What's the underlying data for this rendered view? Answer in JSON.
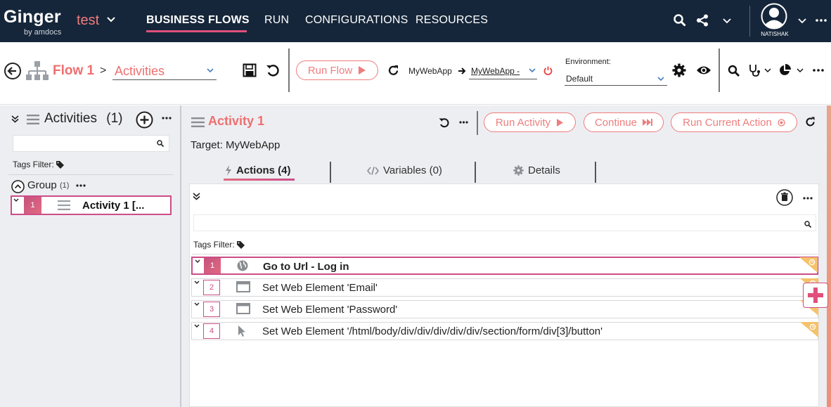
{
  "topbar": {
    "logo": "Ginger",
    "logo_sub": "by amdocs",
    "solution": "test",
    "nav": [
      "BUSINESS FLOWS",
      "RUN",
      "CONFIGURATIONS",
      "RESOURCES"
    ],
    "active_nav": "BUSINESS FLOWS",
    "user": "NATISHAK",
    "icons": [
      "search-icon",
      "share-icon",
      "chevron-down-icon",
      "avatar",
      "more-icon"
    ]
  },
  "toolbar": {
    "flow_name": "Flow 1",
    "separator": ">",
    "view_value": "Activities",
    "run_flow_label": "Run Flow",
    "app_name": "MyWebApp",
    "agent_value": "MyWebApp -",
    "environment_label": "Environment:",
    "environment_value": "Default"
  },
  "left_panel": {
    "title": "Activities",
    "count": "(1)",
    "tags_filter_label": "Tags Filter:",
    "group": {
      "label": "Group",
      "count": "(1)"
    },
    "activities": [
      {
        "number": "1",
        "name": "Activity 1 [..."
      }
    ]
  },
  "activity": {
    "title": "Activity 1",
    "run_activity_label": "Run Activity",
    "continue_label": "Continue",
    "run_current_action_label": "Run Current Action",
    "target": "Target: MyWebApp",
    "tabs": [
      {
        "label": "Actions (4)",
        "icon": "lightning-icon"
      },
      {
        "label": "Variables (0)",
        "icon": "code-icon"
      },
      {
        "label": "Details",
        "icon": "gear-icon"
      }
    ],
    "tags_filter_label": "Tags Filter:",
    "actions": [
      {
        "number": "1",
        "icon": "globe-icon",
        "text": "Go to Url - Log in"
      },
      {
        "number": "2",
        "icon": "window-icon",
        "text": "Set Web Element 'Email'"
      },
      {
        "number": "3",
        "icon": "window-icon",
        "text": "Set Web Element 'Password'"
      },
      {
        "number": "4",
        "icon": "cursor-icon",
        "text": "Set Web Element '/html/body/div/div/div/div/div/section/form/div[3]/button'"
      }
    ]
  },
  "colors": {
    "topbar": "#16263a",
    "accent": "#ef6f6f",
    "pink": "#cc4d86",
    "panel": "#edeef2"
  }
}
